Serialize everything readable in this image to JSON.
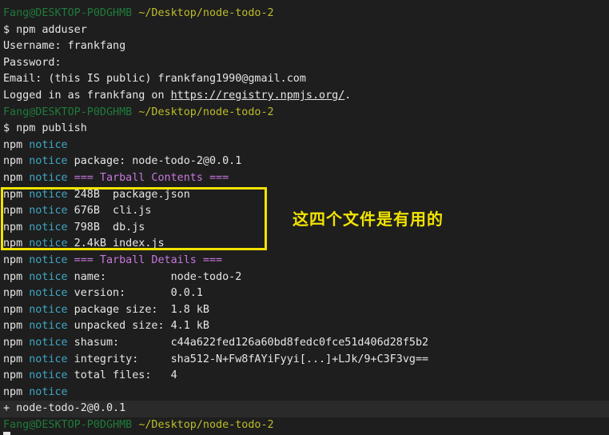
{
  "terminal": {
    "prompt_user": "Fang@DESKTOP-P0DGHMB",
    "prompt_path": "~/Desktop/node-todo-2",
    "lines": [
      {
        "type": "prompt"
      },
      {
        "type": "text",
        "text": "$ npm adduser"
      },
      {
        "type": "text",
        "text": "Username: frankfang"
      },
      {
        "type": "text",
        "text": "Password:"
      },
      {
        "type": "text",
        "text": "Email: (this IS public) frankfang1990@gmail.com"
      },
      {
        "type": "link-line",
        "before": "Logged in as frankfang on ",
        "link": "https://registry.npmjs.org/",
        "after": "."
      },
      {
        "type": "prompt"
      },
      {
        "type": "text",
        "text": "$ npm publish"
      },
      {
        "type": "notice",
        "rest": ""
      },
      {
        "type": "notice",
        "rest": " package: node-todo-2@0.0.1"
      },
      {
        "type": "notice-magenta",
        "rest": " === Tarball Contents ==="
      },
      {
        "type": "notice",
        "rest": " 248B  package.json"
      },
      {
        "type": "notice",
        "rest": " 676B  cli.js"
      },
      {
        "type": "notice",
        "rest": " 798B  db.js"
      },
      {
        "type": "notice",
        "rest": " 2.4kB index.js"
      },
      {
        "type": "notice-magenta",
        "rest": " === Tarball Details ==="
      },
      {
        "type": "notice",
        "rest": " name:          node-todo-2"
      },
      {
        "type": "notice",
        "rest": " version:       0.0.1"
      },
      {
        "type": "notice",
        "rest": " package size:  1.8 kB"
      },
      {
        "type": "notice",
        "rest": " unpacked size: 4.1 kB"
      },
      {
        "type": "notice",
        "rest": " shasum:        c44a622fed126a60bd8fedc0fce51d406d28f5b2"
      },
      {
        "type": "notice",
        "rest": " integrity:     sha512-N+Fw8fAYiFyyi[...]+LJk/9+C3F3vg=="
      },
      {
        "type": "notice",
        "rest": " total files:   4"
      },
      {
        "type": "notice",
        "rest": ""
      },
      {
        "type": "text-hl",
        "text": "+ node-todo-2@0.0.1"
      },
      {
        "type": "prompt"
      }
    ],
    "npm_word": "npm",
    "notice_word": "notice"
  },
  "annotation": {
    "text": "这四个文件是有用的",
    "color": "#f2e300"
  },
  "colors": {
    "background": "#1e1e1e",
    "prompt_user": "#1f7a3a",
    "prompt_path": "#bdbd2a",
    "notice": "#3fa7c4",
    "magenta": "#c678dd"
  }
}
